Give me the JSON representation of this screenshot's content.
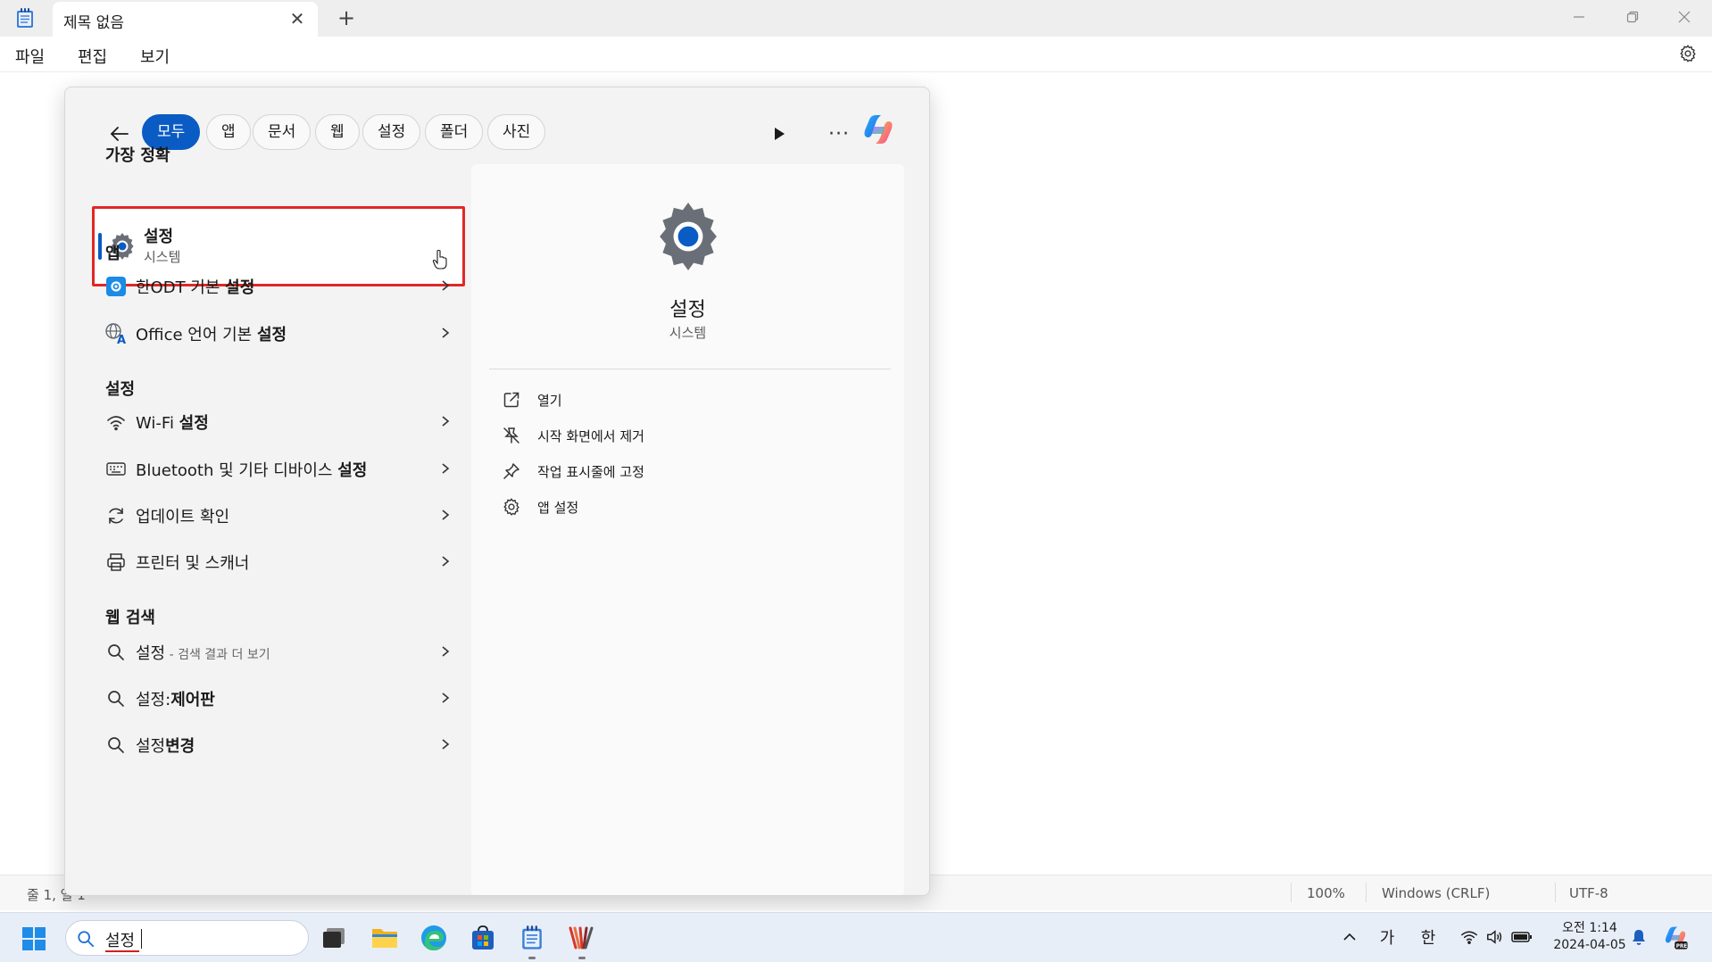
{
  "window": {
    "tab_title": "제목 없음",
    "tab_close_glyph": "✕",
    "new_tab_glyph": "+",
    "icons": [
      "notepad-app-icon",
      "minimize-icon",
      "maximize-icon",
      "close-icon"
    ]
  },
  "menubar": {
    "items": [
      "파일",
      "편집",
      "보기"
    ],
    "settings_icon": "gear-icon"
  },
  "statusbar": {
    "position": "줄 1, 열 1",
    "zoom": "100%",
    "line_ending": "Windows (CRLF)",
    "encoding": "UTF-8"
  },
  "search_flyout": {
    "filter_chips": [
      "모두",
      "앱",
      "문서",
      "웹",
      "설정",
      "폴더",
      "사진"
    ],
    "active_chip": "모두",
    "more_glyph": "···",
    "best_match": {
      "heading": "가장 정확",
      "title": "설정",
      "subtitle": "시스템"
    },
    "apps": {
      "heading": "앱",
      "items": [
        {
          "prefix": "한ODT 기본 ",
          "bold": "설정",
          "suffix": ""
        },
        {
          "prefix": "Office 언어 기본 ",
          "bold": "설정",
          "suffix": ""
        }
      ]
    },
    "settings": {
      "heading": "설정",
      "items": [
        {
          "prefix": "Wi-Fi ",
          "bold": "설정",
          "suffix": ""
        },
        {
          "prefix": "Bluetooth 및 기타 디바이스 ",
          "bold": "설정",
          "suffix": ""
        },
        {
          "prefix": "업데이트 확인",
          "bold": "",
          "suffix": ""
        },
        {
          "prefix": "프린터 및 스캐너",
          "bold": "",
          "suffix": ""
        }
      ]
    },
    "web": {
      "heading": "웹 검색",
      "items": [
        {
          "prefix": "설정",
          "bold": "",
          "suffix": " - 검색 결과 더 보기"
        },
        {
          "prefix": "설정:",
          "bold": "제어판",
          "suffix": ""
        },
        {
          "prefix": "설정",
          "bold": "변경",
          "suffix": ""
        }
      ]
    },
    "preview": {
      "title": "설정",
      "subtitle": "시스템",
      "actions": [
        "열기",
        "시작 화면에서 제거",
        "작업 표시줄에 고정",
        "앱 설정"
      ]
    }
  },
  "taskbar": {
    "search_value": "설정",
    "pinned_apps": [
      "task-view-icon",
      "file-explorer-icon",
      "edge-icon",
      "store-icon",
      "notepad-icon",
      "app-icon"
    ],
    "tray": {
      "ime_mode": "가",
      "ime_lang": "한",
      "chevron": "^"
    },
    "clock": {
      "time": "오전 1:14",
      "date": "2024-04-05"
    }
  },
  "colors": {
    "accent": "#0a5bc4",
    "highlight_border": "#e12727"
  }
}
